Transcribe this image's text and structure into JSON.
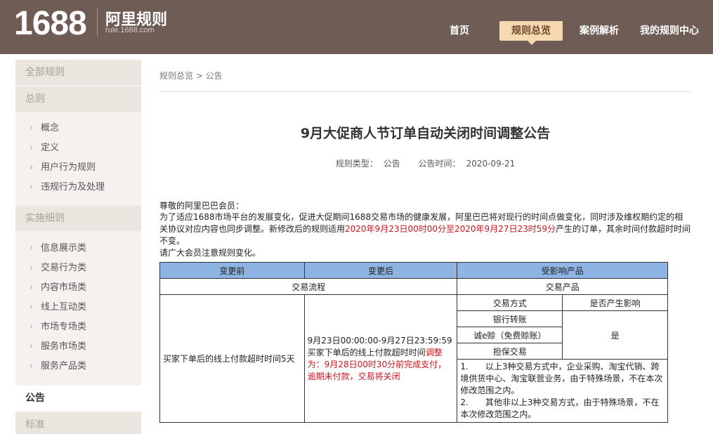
{
  "header": {
    "logo_number": "1688",
    "logo_title": "阿里规则",
    "logo_sub": "rule.1688.com",
    "nav": [
      "首页",
      "规则总览",
      "案例解析",
      "我的规则中心"
    ]
  },
  "sidebar": {
    "all_rules": "全部规则",
    "general": "总则",
    "general_items": [
      "概念",
      "定义",
      "用户行为规则",
      "违规行为及处理"
    ],
    "implementation": "实施细则",
    "implementation_items": [
      "信息展示类",
      "交易行为类",
      "内容市场类",
      "线上互动类",
      "市场专场类",
      "服务市场类",
      "服务产品类"
    ],
    "announcement": "公告",
    "standard": "标准"
  },
  "main": {
    "breadcrumb": "规则总览 > 公告",
    "title": "9月大促商人节订单自动关闭时间调整公告",
    "meta_type_label": "规则类型：",
    "meta_type_value": "公告",
    "meta_time_label": "公告时间：",
    "meta_time_value": "2020-09-21",
    "greeting": "尊敬的阿里巴巴会员：",
    "para_a": "为了适应1688市场平台的发展变化，促进大促期间1688交易市场的健康发展，阿里巴巴将对现行的时间点做变化，同时涉及维权期约定的相关协议对应内容也同步调整。新修改后的规则适用",
    "para_red": "2020年9月23日00时00分至2020年9月27日23时59分",
    "para_b": "产生的订单，其余时间付款超时时间不变。",
    "para_c": "请广大会员注意规则变化。"
  },
  "table": {
    "h_before": "变更前",
    "h_after": "变更后",
    "h_affected": "受影响产品",
    "sub_flow": "交易流程",
    "sub_product": "交易产品",
    "col_method": "交易方式",
    "col_impact": "是否产生影响",
    "before_text": "买家下单后的线上付款超时时间5天",
    "after_a": "9月23日00:00:00-9月27日23:59:59买家下单后的线上付款超时时间",
    "after_red": "调整为：9月28日00时30分前完成支付，逾期未付款，交易将关闭",
    "methods": [
      "银行转账",
      "诚e赊（免费赊账）",
      "担保交易"
    ],
    "impact": "是",
    "note_1": "1.　　以上3种交易方式中，企业采购、淘宝代销、跨境供货中心、淘宝联营业务，由于特殊场景，不在本次修改范围之内。",
    "note_2": "2.　　其他非以上3种交易方式，由于特殊场景，不在本次修改范围之内。"
  }
}
